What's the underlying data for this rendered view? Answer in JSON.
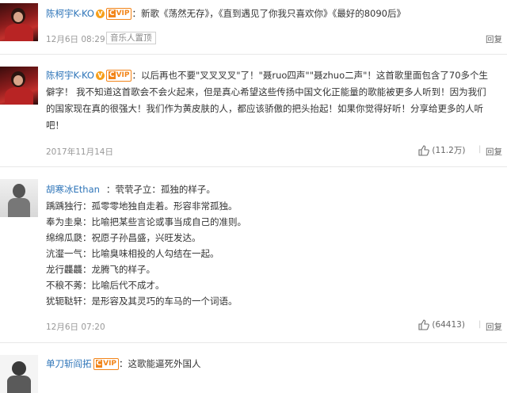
{
  "comments": [
    {
      "username": "陈柯宇K-KO",
      "vip_label": "VIP",
      "text_lines": [
        "：新歌《荡然无存》，《直到遇见了你我只喜欢你》《最好的8090后》"
      ],
      "date": "12月6日 08:29",
      "badge": "音乐人置顶",
      "reply": "回复"
    },
    {
      "username": "陈柯宇K-KO",
      "vip_label": "VIP",
      "text_lines": [
        "：以后再也不要\"叉叉叉叉\"了！\"聂ruo四声\"\"聂zhuo二声\"！这首歌里面包含了70多个生",
        "僻字！ 我不知道这首歌会不会火起来，但是真心希望这些传扬中国文化正能量的歌能被更多人听到！因为我们",
        "的国家现在真的很强大！我们作为黄皮肤的人，都应该骄傲的把头抬起！如果你觉得好听！分享给更多的人听",
        "吧！"
      ],
      "date": "2017年11月14日",
      "likes": "(11.2万)",
      "reply": "回复"
    },
    {
      "username": "胡寒冰Ethan",
      "text_lines": [
        "：茕茕孑立：孤独的样子。",
        "踽踽独行：孤零零地独自走着。形容非常孤独。",
        "奉为圭臬：比喻把某些言论或事当成自己的准则。",
        "绵绵瓜瓞：祝愿子孙昌盛，兴旺发达。",
        "沆瀣一气：比喻臭味相投的人勾结在一起。",
        "龙行龘龘：龙腾飞的样子。",
        "不稂不莠：比喻后代不成才。",
        "犹轭鞑轩：是形容及其灵巧的车马的一个词语。"
      ],
      "date": "12月6日 07:20",
      "likes": "(64413)",
      "reply": "回复"
    },
    {
      "username": "单刀斩阎拓",
      "vip_label": "VIP",
      "text_lines": [
        "：这歌能逼死外国人"
      ]
    }
  ],
  "colors": {
    "link": "#2d74b8",
    "vip": "#f28418",
    "verified": "#f7a01a"
  },
  "icons": {
    "verified": "verified-v-icon",
    "like": "thumbs-up-icon"
  }
}
